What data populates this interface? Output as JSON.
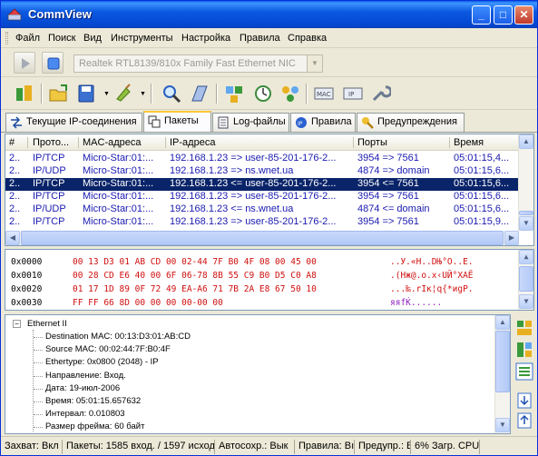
{
  "window": {
    "title": "CommView"
  },
  "menu": [
    "Файл",
    "Поиск",
    "Вид",
    "Инструменты",
    "Настройка",
    "Правила",
    "Справка"
  ],
  "toolbar": {
    "adapter": "Realtek RTL8139/810x Family Fast Ethernet NIC"
  },
  "tabs": [
    "Текущие IP-соединения",
    "Пакеты",
    "Log-файлы",
    "Правила",
    "Предупреждения"
  ],
  "packets": {
    "columns": [
      "Прото...",
      "MAC-адреса",
      "IP-адреса",
      "Порты",
      "Время"
    ],
    "rows": [
      {
        "n": "2..",
        "proto": "IP/TCP",
        "mac": "Micro-Star:01:...",
        "ip": "192.168.1.23 => user-85-201-176-2...",
        "ports": "3954 => 7561",
        "time": "05:01:15,4..."
      },
      {
        "n": "2..",
        "proto": "IP/UDP",
        "mac": "Micro-Star:01:...",
        "ip": "192.168.1.23 => ns.wnet.ua",
        "ports": "4874 => domain",
        "time": "05:01:15,6..."
      },
      {
        "n": "2..",
        "proto": "IP/TCP",
        "mac": "Micro-Star:01:...",
        "ip": "192.168.1.23 <= user-85-201-176-2...",
        "ports": "3954 <= 7561",
        "time": "05:01:15,6...",
        "selected": true
      },
      {
        "n": "2..",
        "proto": "IP/TCP",
        "mac": "Micro-Star:01:...",
        "ip": "192.168.1.23 => user-85-201-176-2...",
        "ports": "3954 => 7561",
        "time": "05:01:15,6..."
      },
      {
        "n": "2..",
        "proto": "IP/UDP",
        "mac": "Micro-Star:01:...",
        "ip": "192.168.1.23 <= ns.wnet.ua",
        "ports": "4874 <= domain",
        "time": "05:01:15,6..."
      },
      {
        "n": "2..",
        "proto": "IP/TCP",
        "mac": "Micro-Star:01:...",
        "ip": "192.168.1.23 => user-85-201-176-2...",
        "ports": "3954 => 7561",
        "time": "05:01:15,9..."
      }
    ]
  },
  "hex": [
    {
      "offset": "0x0000",
      "bytes": "00 13 D3 01 AB CD 00 02-44 7F B0 4F 08 00 45 00",
      "ascii": "..У.«Н..DЊ°O..E."
    },
    {
      "offset": "0x0010",
      "bytes": "00 28 CD E6 40 00 6F 06-78 8B 55 C9 B0 D5 C0 A8",
      "ascii": ".(Нж@.o.x‹UЙ°ХАЁ"
    },
    {
      "offset": "0x0020",
      "bytes": "01 17 1D 89 0F 72 49 EA-A6 71 7B 2A E8 67 50 10",
      "ascii": "...‰.rIк¦q{*иgP."
    },
    {
      "offset": "0x0030",
      "bytes": "FF FF 66 8D 00 00 00 00-00 00",
      "ascii": "яяfЌ......"
    }
  ],
  "decoded": {
    "root": "Ethernet II",
    "items": [
      "Destination MAC: 00:13:D3:01:AB:CD",
      "Source MAC: 00:02:44:7F:B0:4F",
      "Ethertype: 0x0800 (2048) - IP",
      "Направление: Вход.",
      "Дата: 19-июл-2006",
      "Время: 05:01:15.657632",
      "Интервал: 0.010803",
      "Размер фрейма: 60 байт"
    ]
  },
  "status": [
    "Захват: Вкл",
    "Пакеты: 1585 вход. / 1597 исход",
    "Автосохр.: Вык",
    "Правила: Вı",
    "Предупр.: Вı",
    "6% Загр. CPU"
  ]
}
